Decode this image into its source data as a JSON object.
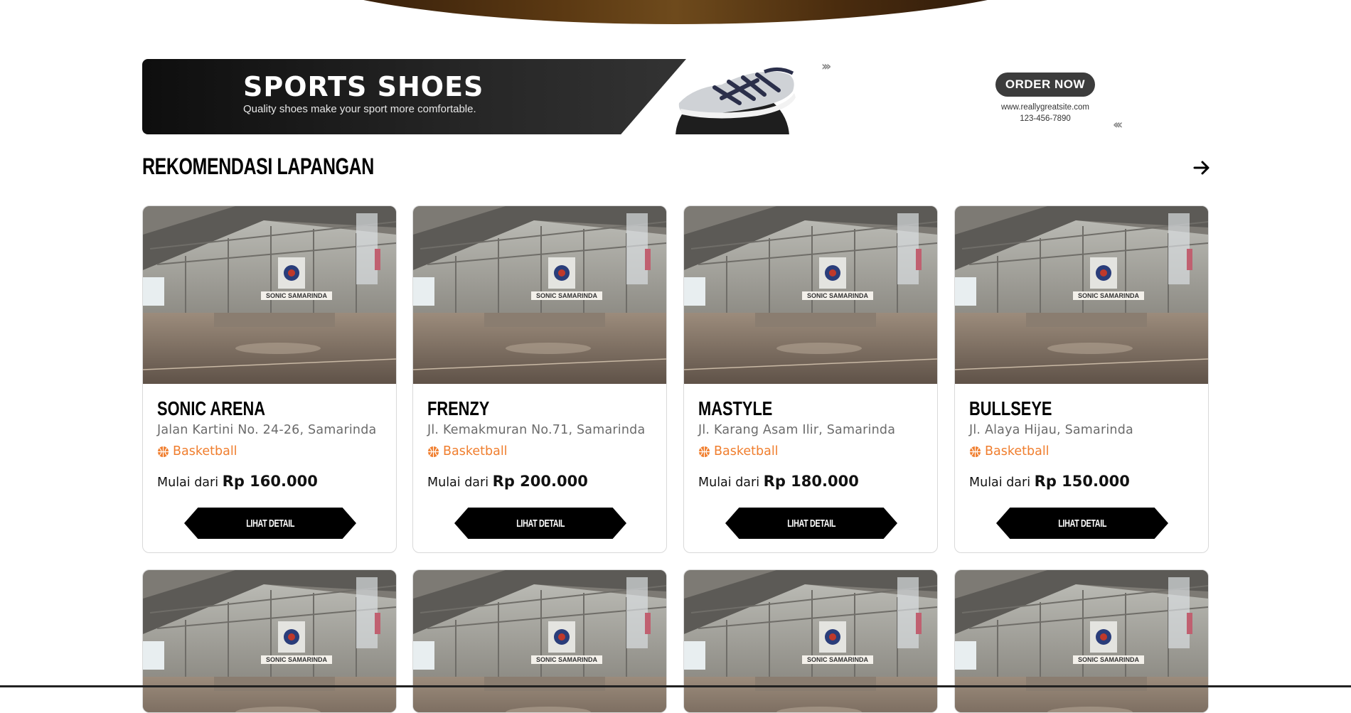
{
  "banner": {
    "title": "SPORTS SHOES",
    "subtitle": "Quality shoes make your sport more comfortable.",
    "cta_label": "ORDER NOW",
    "website": "www.reallygreatsite.com",
    "phone": "123-456-7890"
  },
  "section": {
    "title": "REKOMENDASI LAPANGAN",
    "next_icon": "arrow-right-icon"
  },
  "price_prefix": "Mulai dari",
  "detail_label": "LIHAT DETAIL",
  "venues": [
    {
      "name": "SONIC ARENA",
      "address": "Jalan Kartini No. 24-26, Samarinda",
      "sport": "Basketball",
      "price": "Rp 160.000",
      "image_caption": "SONIC SAMARINDA"
    },
    {
      "name": "FRENZY",
      "address": "Jl. Kemakmuran No.71, Samarinda",
      "sport": "Basketball",
      "price": "Rp 200.000",
      "image_caption": "SONIC SAMARINDA"
    },
    {
      "name": "MASTYLE",
      "address": "Jl. Karang Asam Ilir, Samarinda",
      "sport": "Basketball",
      "price": "Rp 180.000",
      "image_caption": "SONIC SAMARINDA"
    },
    {
      "name": "BULLSEYE",
      "address": "Jl. Alaya Hijau, Samarinda",
      "sport": "Basketball",
      "price": "Rp 150.000",
      "image_caption": "SONIC SAMARINDA"
    },
    {
      "image_caption": "SONIC SAMARINDA"
    },
    {
      "image_caption": "SONIC SAMARINDA"
    },
    {
      "image_caption": "SONIC SAMARINDA"
    },
    {
      "image_caption": "SONIC SAMARINDA"
    }
  ],
  "colors": {
    "accent": "#f07e2e",
    "button": "#000000",
    "text_muted": "#6b6b6b"
  }
}
